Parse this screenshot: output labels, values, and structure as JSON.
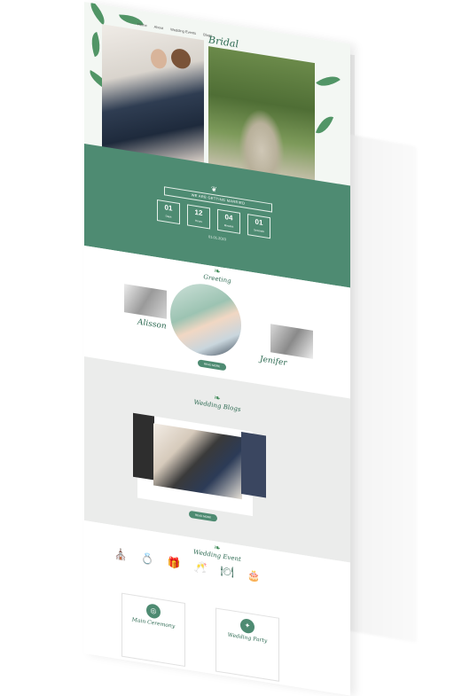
{
  "brand": "Bridal",
  "nav": [
    "Home",
    "About",
    "Wedding Events",
    "Blogs",
    "Gallery",
    "RSVP",
    "Contact"
  ],
  "countdown": {
    "ribbon": "WE ARE GETTING MARRIED",
    "units": [
      {
        "num": "01",
        "label": "Days"
      },
      {
        "num": "12",
        "label": "Hours"
      },
      {
        "num": "04",
        "label": "Minutes"
      },
      {
        "num": "01",
        "label": "Seconds"
      }
    ],
    "sub": "01.01.2023"
  },
  "couple": {
    "title": "Greeting",
    "bride": "Alisson",
    "groom": "Jenifer",
    "button": "READ MORE"
  },
  "blog": {
    "title": "Wedding Blogs",
    "button": "READ MORE"
  },
  "events": {
    "title": "Wedding Event",
    "cards": [
      {
        "title": "Main Ceremony"
      },
      {
        "title": "Wedding Party"
      }
    ]
  },
  "colors": {
    "accent": "#4e8b72",
    "leaf": "#3f8a57"
  }
}
